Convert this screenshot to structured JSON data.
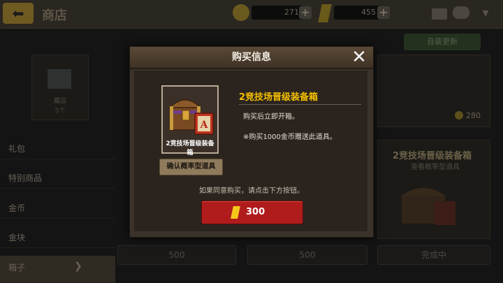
{
  "topbar": {
    "title": "商店",
    "coins": "271",
    "gold": "455"
  },
  "sidebar": {
    "items": [
      {
        "label": "礼包"
      },
      {
        "label": "特别商品"
      },
      {
        "label": "金币"
      },
      {
        "label": "金块"
      },
      {
        "label": "箱子"
      }
    ]
  },
  "background": {
    "refresh_button": "自装更新",
    "left_card_caption": "5个",
    "left_card_name": "藏品",
    "right_card_price": "280",
    "right_card_title": "2竞技场晋级装备箱",
    "right_card_sub": "查看概率型道具",
    "bottom_prices": [
      "500",
      "500",
      "完成中"
    ]
  },
  "modal": {
    "title": "购买信息",
    "item_label": "2竞技场晋级装备箱",
    "item_name": "2竞技场晋级装备箱",
    "probability_button": "确认概率型道具",
    "desc_line1": "购买后立即开箱。",
    "desc_line2": "※购买1000金币赠送此道具。",
    "hint": "如果同意购买，请点击下方按钮。",
    "price": "300"
  },
  "colors": {
    "accent_yellow": "#f5c000",
    "buy_red": "#b01c1c"
  }
}
